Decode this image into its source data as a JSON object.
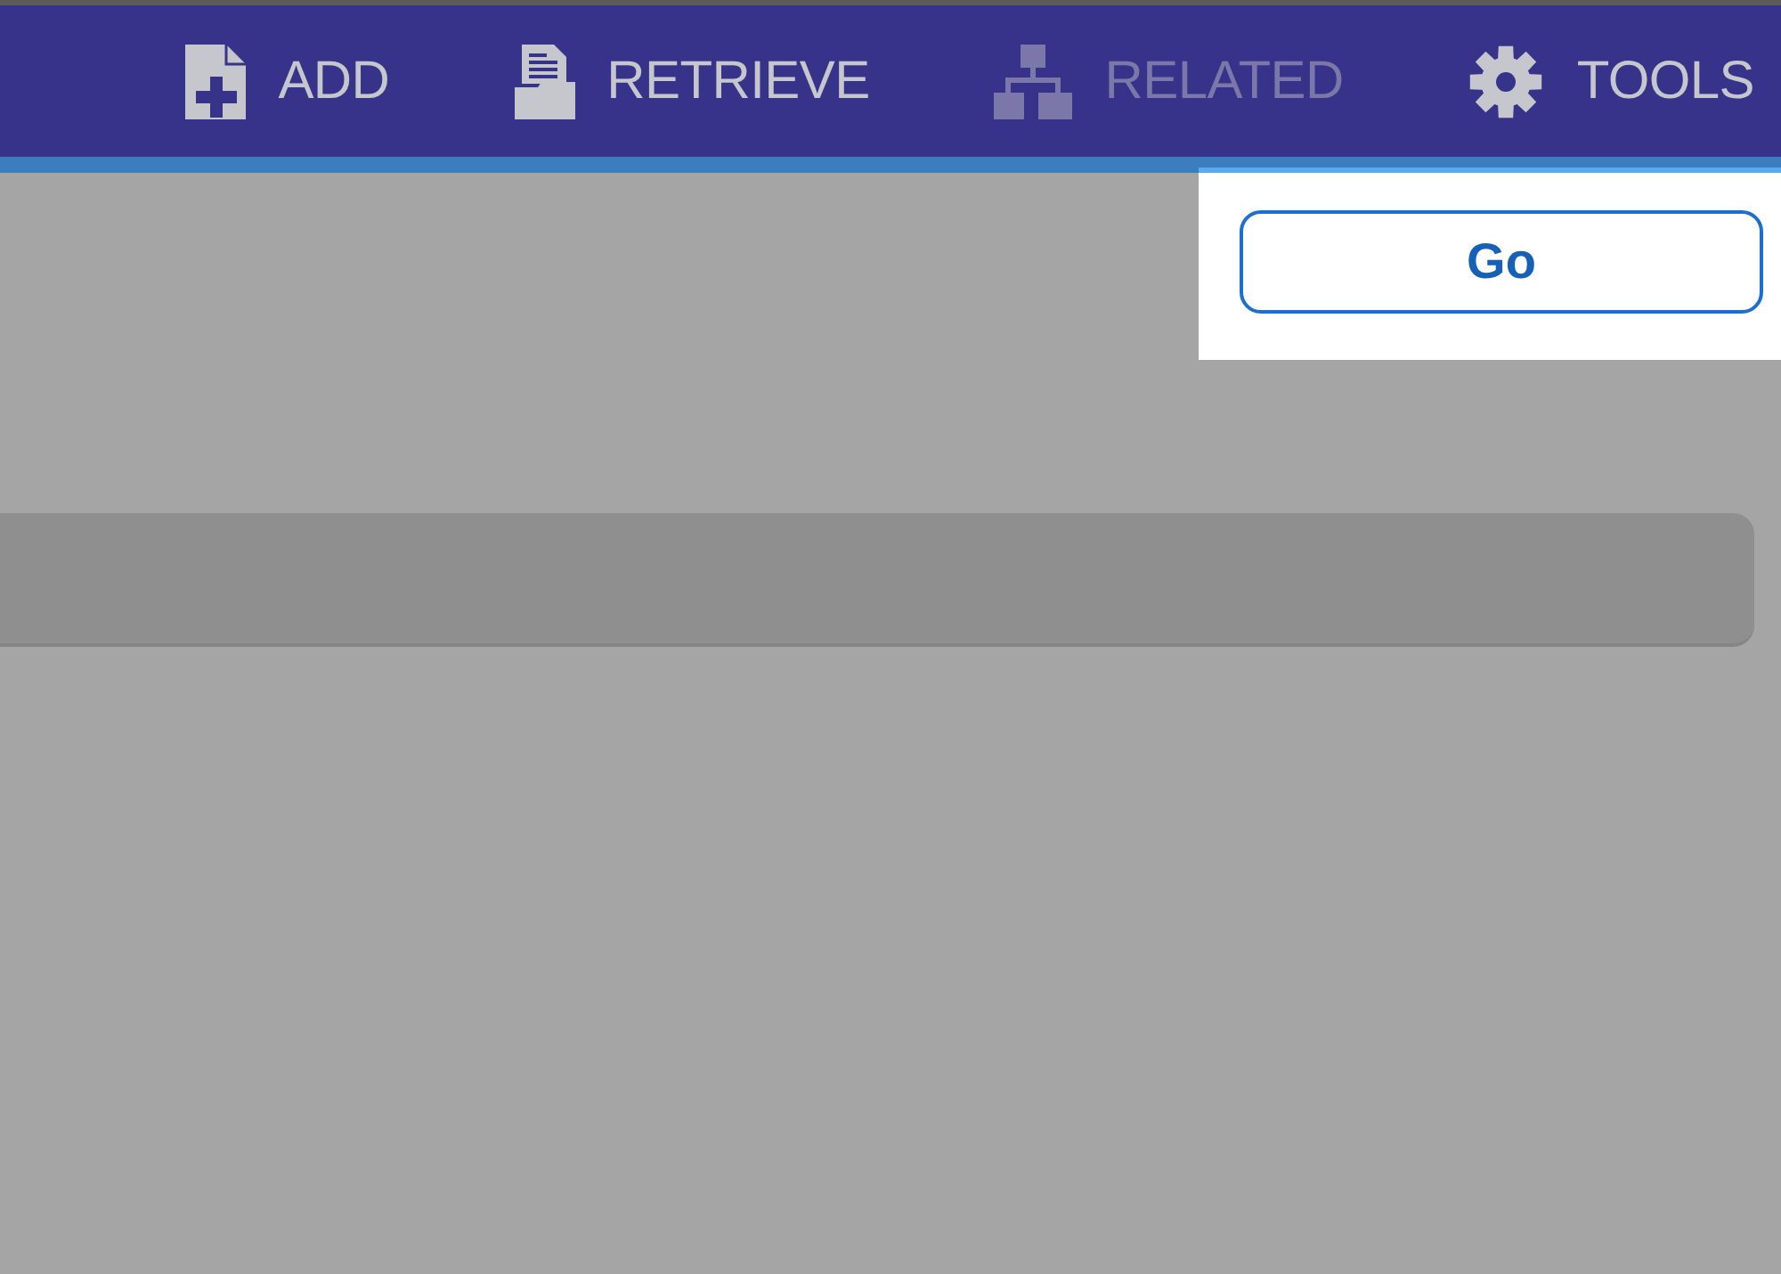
{
  "nav_items": [
    {
      "kind": "add",
      "label": "ADD",
      "disabled": false
    },
    {
      "kind": "retrieve",
      "label": "RETRIEVE",
      "disabled": false
    },
    {
      "kind": "related",
      "label": "RELATED",
      "disabled": true
    },
    {
      "kind": "tools",
      "label": "TOOLS",
      "disabled": false
    }
  ],
  "go_button": {
    "label": "Go"
  }
}
